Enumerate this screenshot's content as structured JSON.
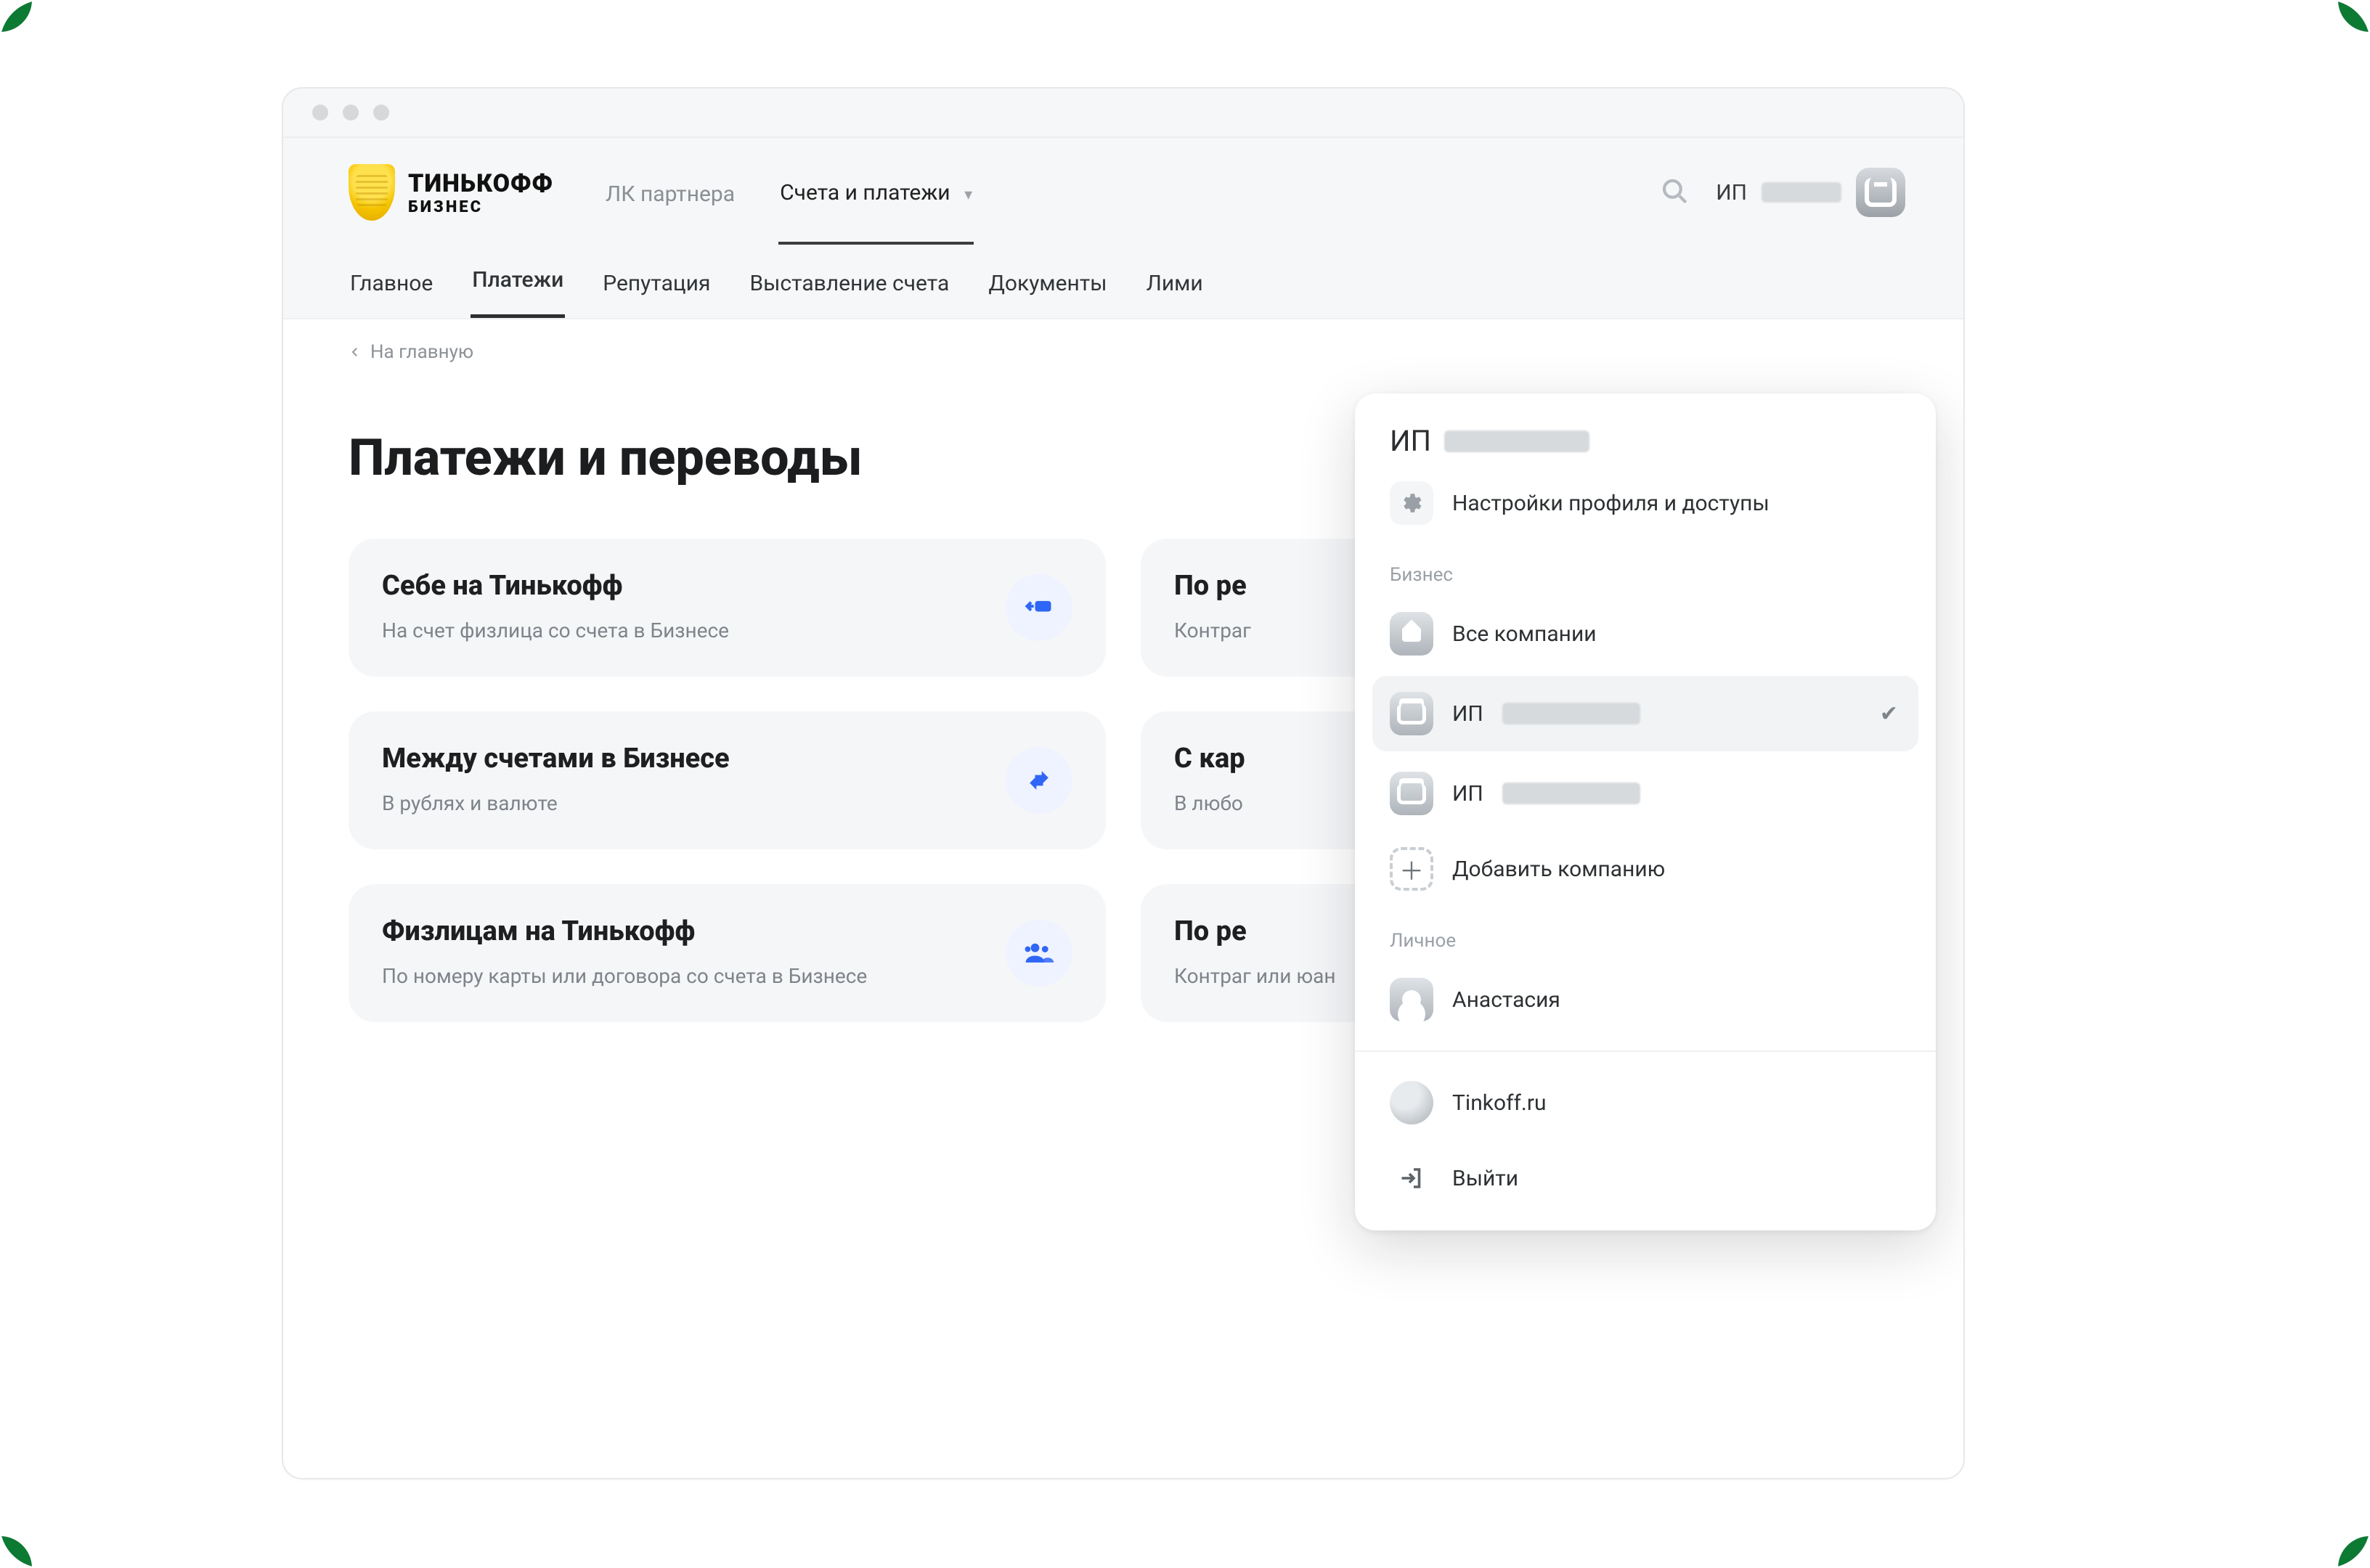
{
  "brand": {
    "line1": "ТИНЬКОФФ",
    "line2": "БИЗНЕС"
  },
  "topnav": {
    "links": [
      {
        "label": "ЛК партнера",
        "active": false
      },
      {
        "label": "Счета и платежи",
        "active": true,
        "chevron": true
      }
    ],
    "user_prefix": "ИП"
  },
  "subnav": {
    "items": [
      {
        "label": "Главное"
      },
      {
        "label": "Платежи",
        "active": true
      },
      {
        "label": "Репутация"
      },
      {
        "label": "Выставление счета"
      },
      {
        "label": "Документы"
      },
      {
        "label": "Лими"
      }
    ]
  },
  "breadcrumb_back": "На главную",
  "page_title": "Платежи и переводы",
  "cards": [
    {
      "title": "Себе на Тинькофф",
      "sub": "На счет физлица со счета в Бизнесе"
    },
    {
      "title": "По ре",
      "sub": "Контраг"
    },
    {
      "title": "Между счетами в Бизнесе",
      "sub": "В рублях и валюте"
    },
    {
      "title": "С кар",
      "sub": "В любо"
    },
    {
      "title": "Физлицам на Тинькофф",
      "sub": "По номеру карты или договора со счета в Бизнесе"
    },
    {
      "title": "По ре",
      "sub": "Контраг или юан"
    }
  ],
  "profile_menu": {
    "heading_prefix": "ИП",
    "settings": "Настройки профиля и доступы",
    "section_business": "Бизнес",
    "all_companies": "Все компании",
    "company_prefix": "ИП",
    "add_company": "Добавить компанию",
    "section_personal": "Личное",
    "personal_name": "Анастасия",
    "site": "Tinkoff.ru",
    "logout": "Выйти"
  }
}
